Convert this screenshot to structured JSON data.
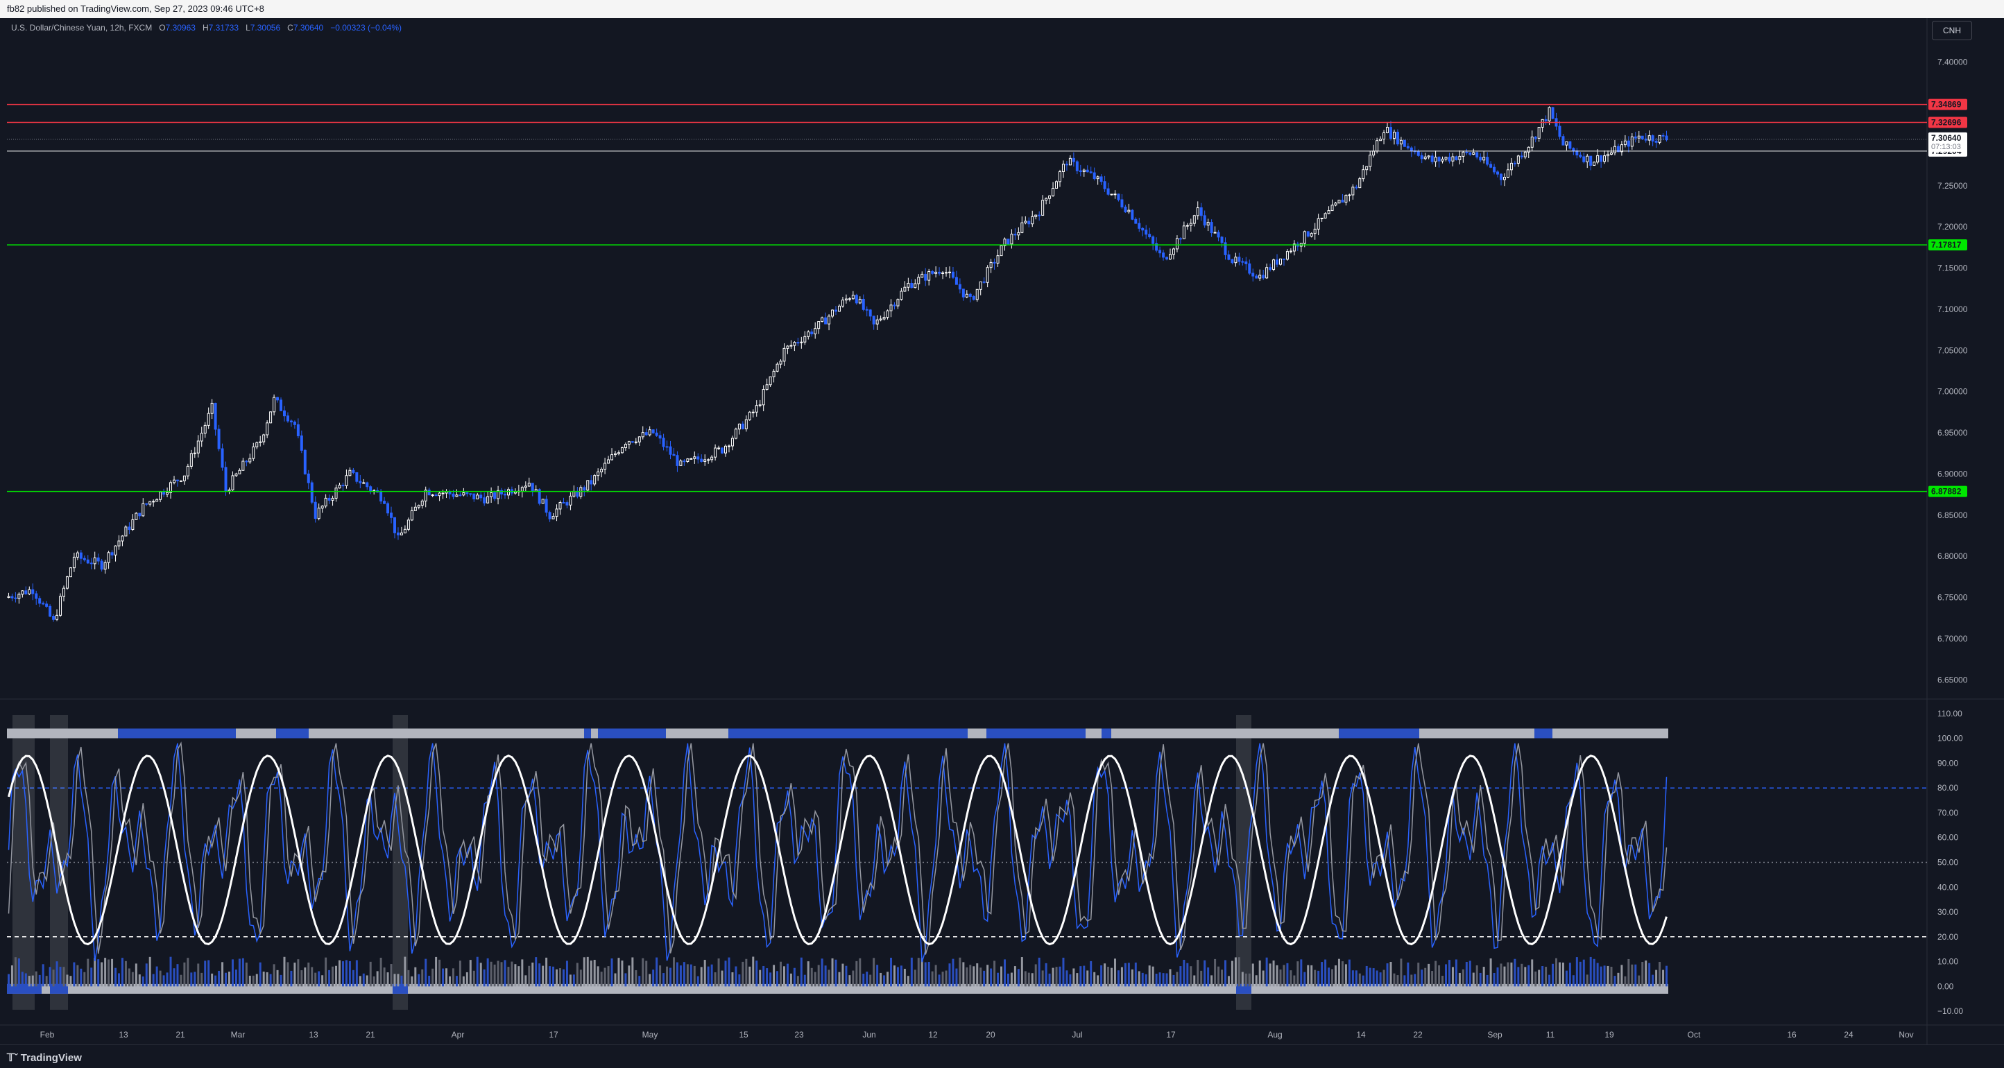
{
  "header": {
    "published_text": "fb82 published on TradingView.com, Sep 27, 2023 09:46 UTC+8"
  },
  "symbol": {
    "title": "U.S. Dollar/Chinese Yuan, 12h, FXCM",
    "open_label": "O",
    "open": "7.30963",
    "high_label": "H",
    "high": "7.31733",
    "low_label": "L",
    "low": "7.30056",
    "close_label": "C",
    "close": "7.30640",
    "change": "−0.00323 (−0.04%)"
  },
  "currency_button": "CNH",
  "price_axis": {
    "ticks": [
      "7.40000",
      "7.35000",
      "7.30000",
      "7.25000",
      "7.20000",
      "7.15000",
      "7.10000",
      "7.05000",
      "7.00000",
      "6.95000",
      "6.90000",
      "6.85000",
      "6.80000",
      "6.75000",
      "6.70000",
      "6.65000"
    ],
    "tick_values": [
      7.4,
      7.35,
      7.3,
      7.25,
      7.2,
      7.15,
      7.1,
      7.05,
      7.0,
      6.95,
      6.9,
      6.85,
      6.8,
      6.75,
      6.7,
      6.65
    ]
  },
  "levels": [
    {
      "price": 7.34869,
      "label": "7.34869",
      "color": "#f23645"
    },
    {
      "price": 7.32696,
      "label": "7.32696",
      "color": "#f23645"
    },
    {
      "price": 7.29204,
      "label": "7.29204",
      "color": "#ffffff"
    },
    {
      "price": 7.17817,
      "label": "7.17817",
      "color": "#00e600"
    },
    {
      "price": 6.87882,
      "label": "6.87882",
      "color": "#00e600"
    }
  ],
  "current_price": {
    "label": "7.30640",
    "countdown": "07:13:03",
    "price": 7.3064
  },
  "osc_axis": {
    "ticks": [
      "110.00",
      "100.00",
      "90.00",
      "80.00",
      "70.00",
      "60.00",
      "50.00",
      "40.00",
      "30.00",
      "20.00",
      "10.00",
      "0.00",
      "−10.00"
    ],
    "tick_values": [
      110,
      100,
      90,
      80,
      70,
      60,
      50,
      40,
      30,
      20,
      10,
      0,
      -10
    ]
  },
  "time_axis": {
    "labels": [
      "Feb",
      "13",
      "21",
      "Mar",
      "13",
      "21",
      "Apr",
      "17",
      "May",
      "15",
      "23",
      "Jun",
      "12",
      "20",
      "Jul",
      "17",
      "Aug",
      "14",
      "22",
      "Sep",
      "11",
      "19",
      "Oct",
      "16",
      "24",
      "Nov"
    ]
  },
  "footer": {
    "logo_text": "TradingView"
  },
  "chart_data": {
    "type": "candlestick",
    "symbol": "USDCNH",
    "timeframe": "12h",
    "anchors": [
      {
        "t": 0,
        "p": 6.75
      },
      {
        "t": 8,
        "p": 6.76
      },
      {
        "t": 14,
        "p": 6.72
      },
      {
        "t": 20,
        "p": 6.8
      },
      {
        "t": 28,
        "p": 6.79
      },
      {
        "t": 40,
        "p": 6.86
      },
      {
        "t": 52,
        "p": 6.9
      },
      {
        "t": 60,
        "p": 6.98
      },
      {
        "t": 64,
        "p": 6.88
      },
      {
        "t": 74,
        "p": 6.94
      },
      {
        "t": 78,
        "p": 6.99
      },
      {
        "t": 84,
        "p": 6.96
      },
      {
        "t": 90,
        "p": 6.85
      },
      {
        "t": 100,
        "p": 6.9
      },
      {
        "t": 110,
        "p": 6.87
      },
      {
        "t": 114,
        "p": 6.82
      },
      {
        "t": 122,
        "p": 6.88
      },
      {
        "t": 140,
        "p": 6.87
      },
      {
        "t": 152,
        "p": 6.89
      },
      {
        "t": 158,
        "p": 6.85
      },
      {
        "t": 170,
        "p": 6.89
      },
      {
        "t": 180,
        "p": 6.94
      },
      {
        "t": 188,
        "p": 6.95
      },
      {
        "t": 196,
        "p": 6.91
      },
      {
        "t": 208,
        "p": 6.93
      },
      {
        "t": 218,
        "p": 6.98
      },
      {
        "t": 226,
        "p": 7.05
      },
      {
        "t": 236,
        "p": 7.08
      },
      {
        "t": 246,
        "p": 7.12
      },
      {
        "t": 252,
        "p": 7.08
      },
      {
        "t": 262,
        "p": 7.13
      },
      {
        "t": 272,
        "p": 7.15
      },
      {
        "t": 280,
        "p": 7.11
      },
      {
        "t": 290,
        "p": 7.18
      },
      {
        "t": 300,
        "p": 7.22
      },
      {
        "t": 308,
        "p": 7.28
      },
      {
        "t": 316,
        "p": 7.26
      },
      {
        "t": 326,
        "p": 7.22
      },
      {
        "t": 336,
        "p": 7.16
      },
      {
        "t": 346,
        "p": 7.22
      },
      {
        "t": 356,
        "p": 7.16
      },
      {
        "t": 364,
        "p": 7.14
      },
      {
        "t": 372,
        "p": 7.17
      },
      {
        "t": 380,
        "p": 7.2
      },
      {
        "t": 392,
        "p": 7.25
      },
      {
        "t": 400,
        "p": 7.32
      },
      {
        "t": 406,
        "p": 7.3
      },
      {
        "t": 414,
        "p": 7.28
      },
      {
        "t": 426,
        "p": 7.29
      },
      {
        "t": 434,
        "p": 7.26
      },
      {
        "t": 442,
        "p": 7.3
      },
      {
        "t": 448,
        "p": 7.34
      },
      {
        "t": 452,
        "p": 7.3
      },
      {
        "t": 460,
        "p": 7.28
      },
      {
        "t": 466,
        "p": 7.29
      },
      {
        "t": 474,
        "p": 7.31
      },
      {
        "t": 482,
        "p": 7.307
      }
    ],
    "candle_count": 482,
    "price_range": [
      6.63,
      7.42
    ],
    "osc_range": [
      -15,
      115
    ],
    "osc_levels": [
      {
        "value": 80,
        "style": "dashed",
        "color": "#2962ff"
      },
      {
        "value": 50,
        "style": "dotted",
        "color": "#787b86"
      },
      {
        "value": 20,
        "style": "dashed",
        "color": "#ffffff"
      }
    ]
  }
}
